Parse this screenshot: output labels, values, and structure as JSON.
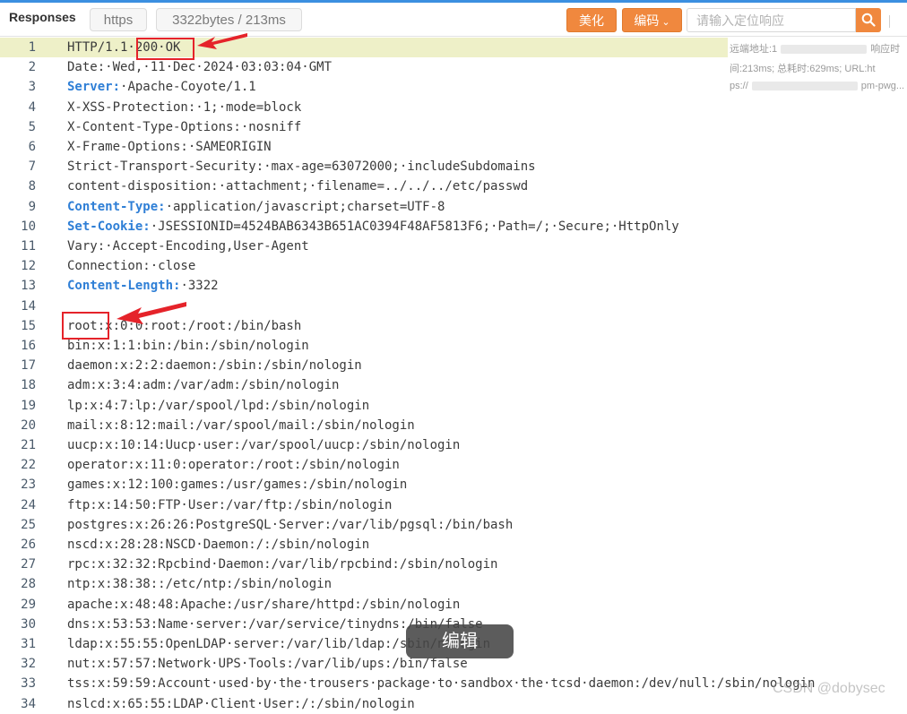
{
  "header": {
    "title": "Responses",
    "protocol": "https",
    "stats": "3322bytes / 213ms",
    "beautify_label": "美化",
    "encode_label": "编码",
    "search_placeholder": "请输入定位响应"
  },
  "side_info": {
    "line1_a": "远端地址:1",
    "line1_b": "响应时",
    "line2": "间:213ms; 总耗时:629ms; URL:ht",
    "line3_a": "ps://",
    "line3_b": "pm-pwg..."
  },
  "lines": [
    {
      "n": "1",
      "k": "",
      "v": "HTTP/1.1·200·OK"
    },
    {
      "n": "2",
      "k": "",
      "v": "Date:·Wed,·11·Dec·2024·03:03:04·GMT"
    },
    {
      "n": "3",
      "k": "Server:",
      "v": "·Apache-Coyote/1.1"
    },
    {
      "n": "4",
      "k": "",
      "v": "X-XSS-Protection:·1;·mode=block"
    },
    {
      "n": "5",
      "k": "",
      "v": "X-Content-Type-Options:·nosniff"
    },
    {
      "n": "6",
      "k": "",
      "v": "X-Frame-Options:·SAMEORIGIN"
    },
    {
      "n": "7",
      "k": "",
      "v": "Strict-Transport-Security:·max-age=63072000;·includeSubdomains"
    },
    {
      "n": "8",
      "k": "",
      "v": "content-disposition:·attachment;·filename=../../../etc/passwd"
    },
    {
      "n": "9",
      "k": "Content-Type:",
      "v": "·application/javascript;charset=UTF-8"
    },
    {
      "n": "10",
      "k": "Set-Cookie:",
      "v": "·JSESSIONID=4524BAB6343B651AC0394F48AF5813F6;·Path=/;·Secure;·HttpOnly"
    },
    {
      "n": "11",
      "k": "",
      "v": "Vary:·Accept-Encoding,User-Agent"
    },
    {
      "n": "12",
      "k": "",
      "v": "Connection:·close"
    },
    {
      "n": "13",
      "k": "Content-Length:",
      "v": "·3322"
    },
    {
      "n": "14",
      "k": "",
      "v": ""
    },
    {
      "n": "15",
      "k": "",
      "v": "root:x:0:0:root:/root:/bin/bash"
    },
    {
      "n": "16",
      "k": "",
      "v": "bin:x:1:1:bin:/bin:/sbin/nologin"
    },
    {
      "n": "17",
      "k": "",
      "v": "daemon:x:2:2:daemon:/sbin:/sbin/nologin"
    },
    {
      "n": "18",
      "k": "",
      "v": "adm:x:3:4:adm:/var/adm:/sbin/nologin"
    },
    {
      "n": "19",
      "k": "",
      "v": "lp:x:4:7:lp:/var/spool/lpd:/sbin/nologin"
    },
    {
      "n": "20",
      "k": "",
      "v": "mail:x:8:12:mail:/var/spool/mail:/sbin/nologin"
    },
    {
      "n": "21",
      "k": "",
      "v": "uucp:x:10:14:Uucp·user:/var/spool/uucp:/sbin/nologin"
    },
    {
      "n": "22",
      "k": "",
      "v": "operator:x:11:0:operator:/root:/sbin/nologin"
    },
    {
      "n": "23",
      "k": "",
      "v": "games:x:12:100:games:/usr/games:/sbin/nologin"
    },
    {
      "n": "24",
      "k": "",
      "v": "ftp:x:14:50:FTP·User:/var/ftp:/sbin/nologin"
    },
    {
      "n": "25",
      "k": "",
      "v": "postgres:x:26:26:PostgreSQL·Server:/var/lib/pgsql:/bin/bash"
    },
    {
      "n": "26",
      "k": "",
      "v": "nscd:x:28:28:NSCD·Daemon:/:/sbin/nologin"
    },
    {
      "n": "27",
      "k": "",
      "v": "rpc:x:32:32:Rpcbind·Daemon:/var/lib/rpcbind:/sbin/nologin"
    },
    {
      "n": "28",
      "k": "",
      "v": "ntp:x:38:38::/etc/ntp:/sbin/nologin"
    },
    {
      "n": "29",
      "k": "",
      "v": "apache:x:48:48:Apache:/usr/share/httpd:/sbin/nologin"
    },
    {
      "n": "30",
      "k": "",
      "v": "dns:x:53:53:Name·server:/var/service/tinydns:/bin/false"
    },
    {
      "n": "31",
      "k": "",
      "v": "ldap:x:55:55:OpenLDAP·server:/var/lib/ldap:/sbin/nologin"
    },
    {
      "n": "32",
      "k": "",
      "v": "nut:x:57:57:Network·UPS·Tools:/var/lib/ups:/bin/false"
    },
    {
      "n": "33",
      "k": "",
      "v": "tss:x:59:59:Account·used·by·the·trousers·package·to·sandbox·the·tcsd·daemon:/dev/null:/sbin/nologin"
    },
    {
      "n": "34",
      "k": "",
      "v": "nslcd:x:65:55:LDAP·Client·User:/:/sbin/nologin"
    }
  ],
  "edit_tooltip": "编辑",
  "watermark": "CSDN @dobysec",
  "icons": {
    "search": "search-icon",
    "arrow": "red-arrow-annotation"
  },
  "colors": {
    "accent_orange": "#f0883e",
    "header_key_blue": "#2f7fd6",
    "highlight_line": "#eef0c8",
    "annotation_red": "#e5232a"
  }
}
